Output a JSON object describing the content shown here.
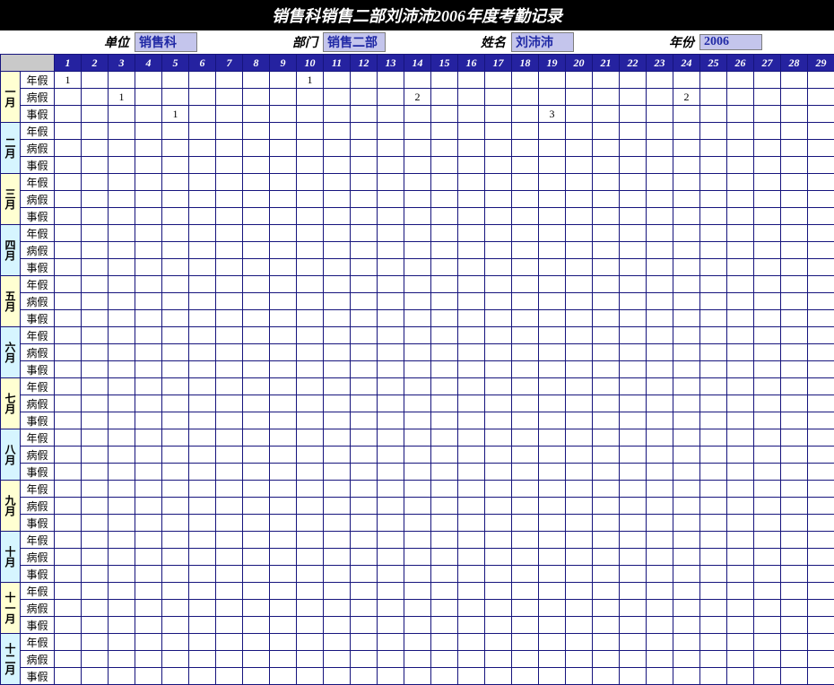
{
  "title": "销售科销售二部刘沛沛2006年度考勤记录",
  "meta": {
    "unit_label": "单位",
    "unit_value": "销售科",
    "dept_label": "部门",
    "dept_value": "销售二部",
    "name_label": "姓名",
    "name_value": "刘沛沛",
    "year_label": "年份",
    "year_value": "2006"
  },
  "day_headers": [
    "1",
    "2",
    "3",
    "4",
    "5",
    "6",
    "7",
    "8",
    "9",
    "10",
    "11",
    "12",
    "13",
    "14",
    "15",
    "16",
    "17",
    "18",
    "19",
    "20",
    "21",
    "22",
    "23",
    "24",
    "25",
    "26",
    "27",
    "28",
    "29"
  ],
  "months": [
    "一月",
    "二月",
    "三月",
    "四月",
    "五月",
    "六月",
    "七月",
    "八月",
    "九月",
    "十月",
    "十一月",
    "十二月"
  ],
  "leave_types": [
    "年假",
    "病假",
    "事假"
  ],
  "records": {
    "一月-年假": {
      "1": "1",
      "10": "1"
    },
    "一月-病假": {
      "3": "1",
      "14": "2",
      "24": "2"
    },
    "一月-事假": {
      "5": "1",
      "19": "3"
    }
  }
}
